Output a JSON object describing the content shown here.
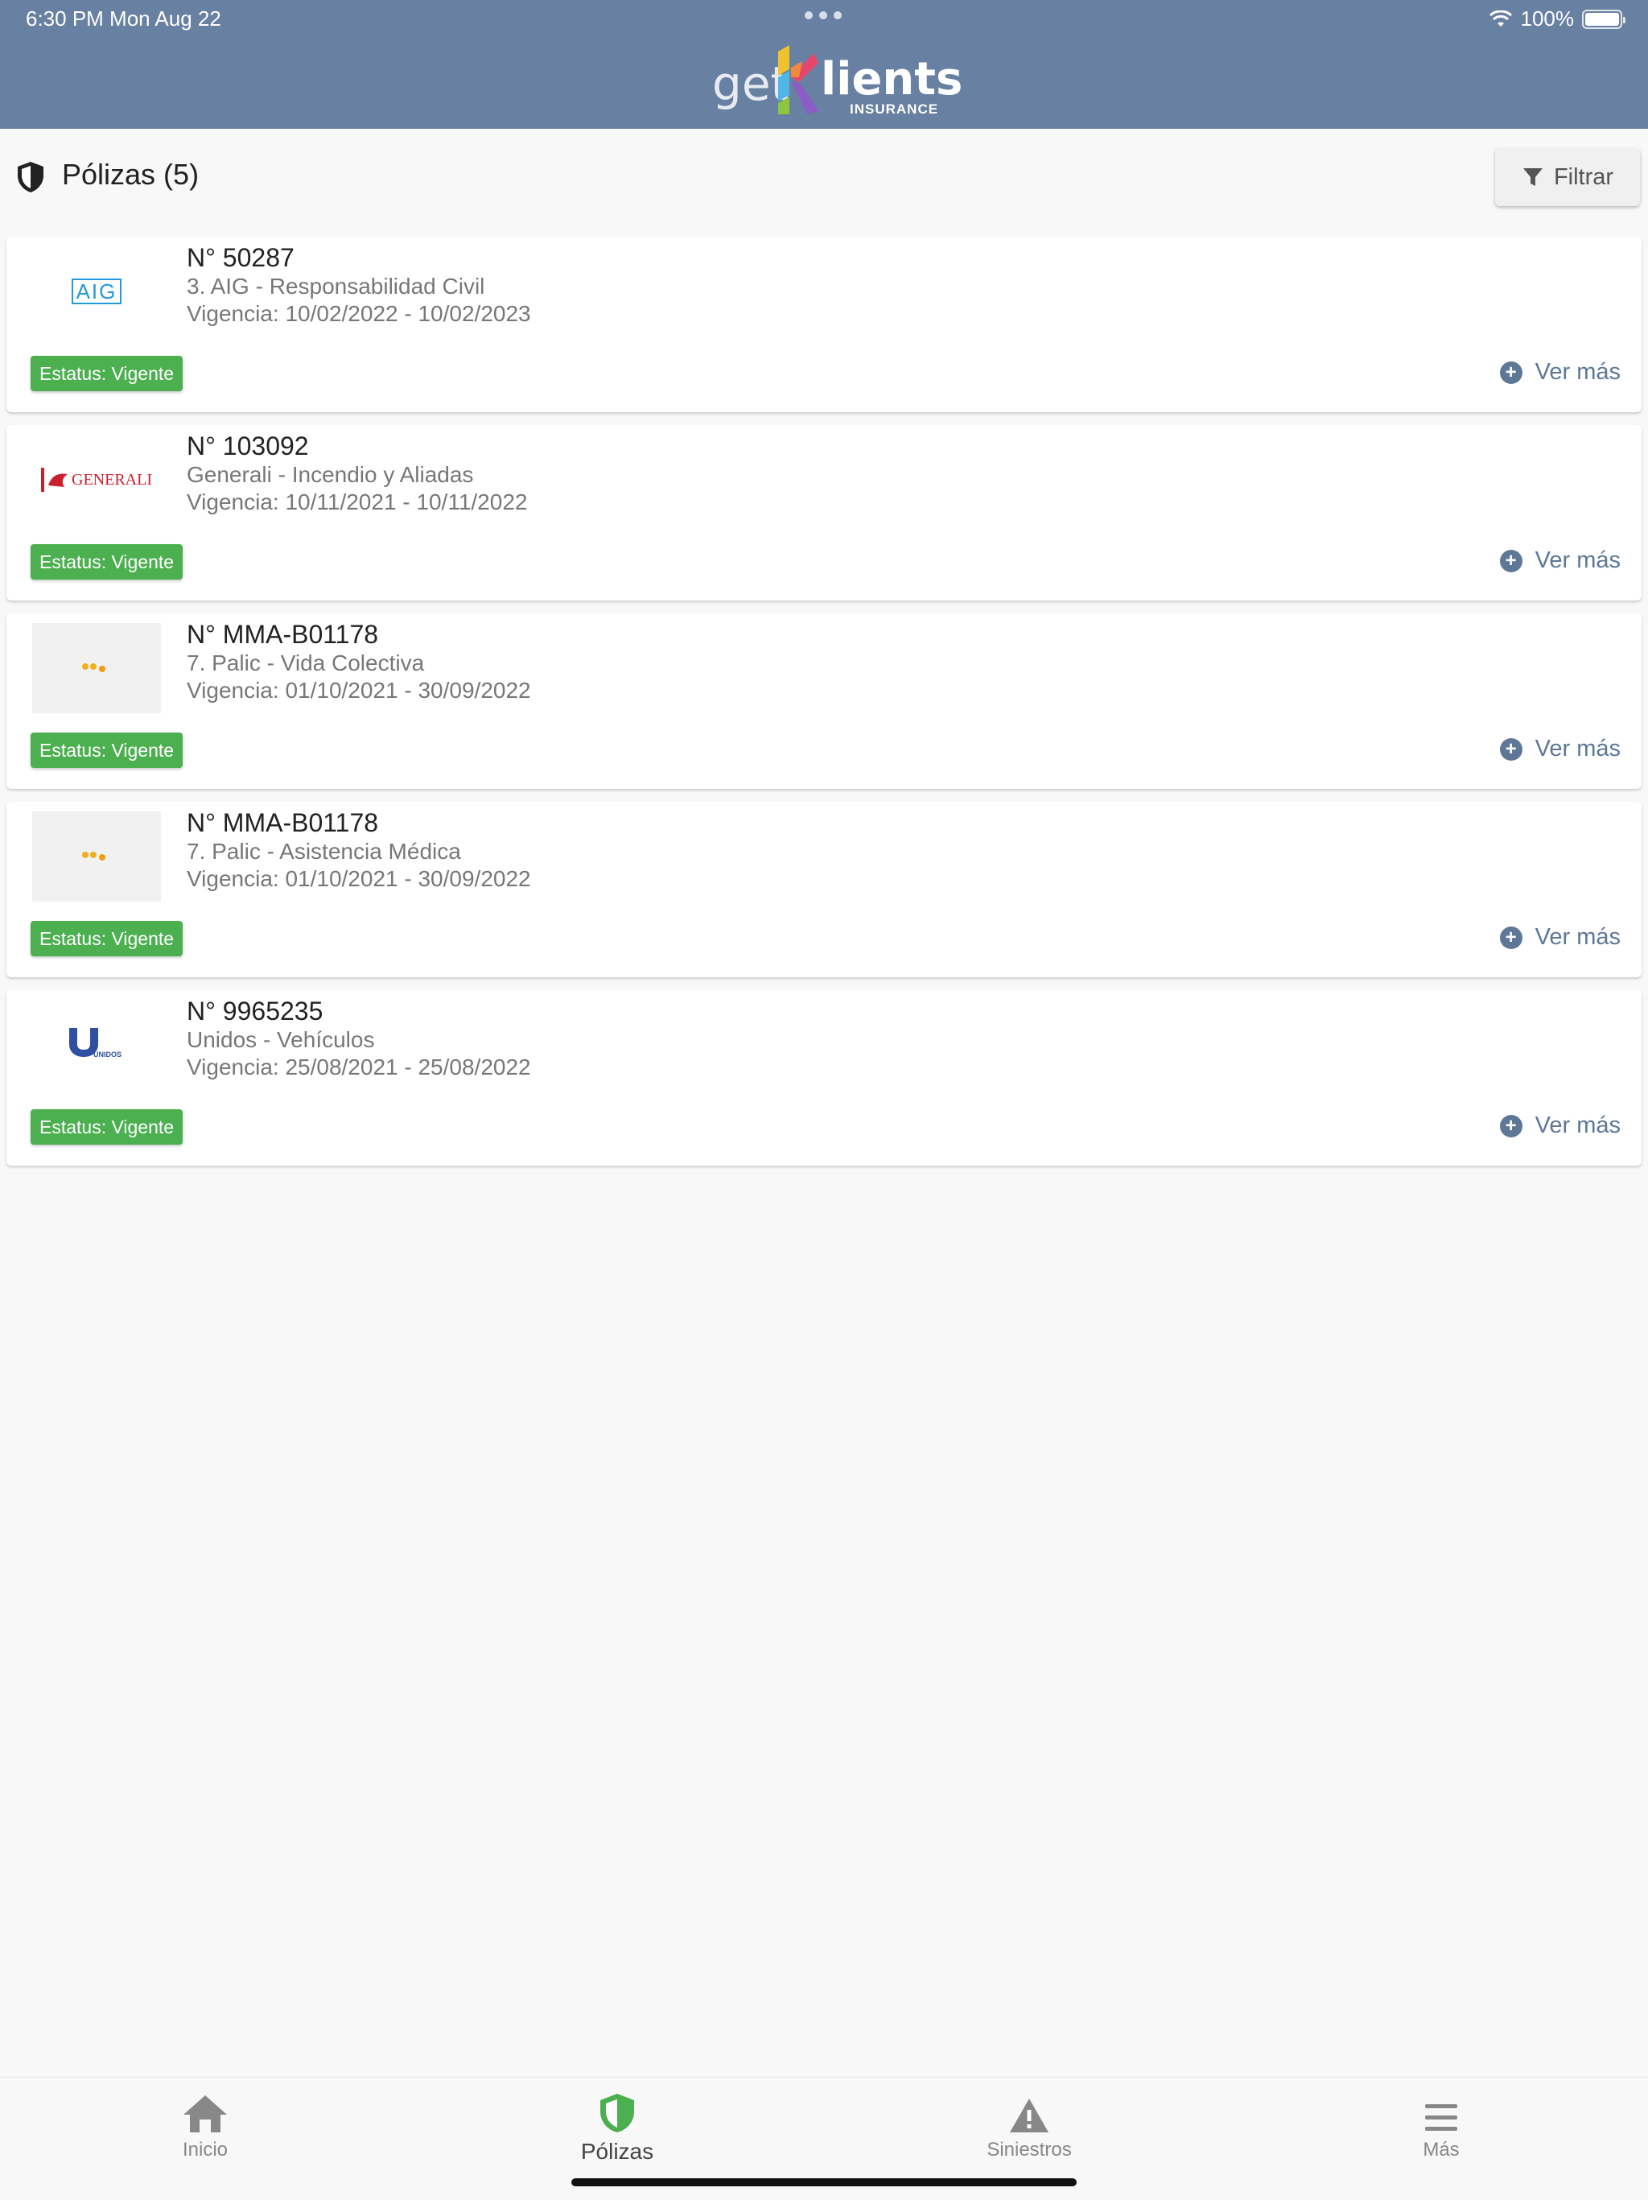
{
  "status_bar": {
    "time": "6:30 PM   Mon Aug 22",
    "battery": "100%"
  },
  "brand": {
    "get": "get",
    "k": "K",
    "lients": "lients",
    "insurance": "INSURANCE"
  },
  "page": {
    "title": "Pólizas (5)",
    "filter_label": "Filtrar"
  },
  "policies": [
    {
      "logo": "AIG",
      "number": "N° 50287",
      "product": "3. AIG - Responsabilidad Civil",
      "validity": "Vigencia: 10/02/2022 - 10/02/2023",
      "status": "Estatus: Vigente",
      "more": "Ver más"
    },
    {
      "logo": "GENERALI",
      "number": "N° 103092",
      "product": "Generali - Incendio y Aliadas",
      "validity": "Vigencia: 10/11/2021 - 10/11/2022",
      "status": "Estatus: Vigente",
      "more": "Ver más"
    },
    {
      "logo": "placeholder",
      "number": "N° MMA-B01178",
      "product": "7. Palic - Vida Colectiva",
      "validity": "Vigencia: 01/10/2021 - 30/09/2022",
      "status": "Estatus: Vigente",
      "more": "Ver más"
    },
    {
      "logo": "placeholder",
      "number": "N° MMA-B01178",
      "product": "7. Palic - Asistencia Médica",
      "validity": "Vigencia: 01/10/2021 - 30/09/2022",
      "status": "Estatus: Vigente",
      "more": "Ver más"
    },
    {
      "logo": "UNIDOS",
      "number": "N° 9965235",
      "product": "Unidos - Vehículos",
      "validity": "Vigencia: 25/08/2021 - 25/08/2022",
      "status": "Estatus: Vigente",
      "more": "Ver más"
    }
  ],
  "logo_text": {
    "aig": "AIG",
    "generali": "GENERALI",
    "unidos": "UNIDOS"
  },
  "nav": {
    "inicio": "Inicio",
    "polizas": "Pólizas",
    "siniestros": "Siniestros",
    "mas": "Más",
    "active": "polizas"
  },
  "colors": {
    "header": "#6880a2",
    "badge": "#4caf50",
    "accent": "#5e7797",
    "active_icon": "#4caf50"
  }
}
